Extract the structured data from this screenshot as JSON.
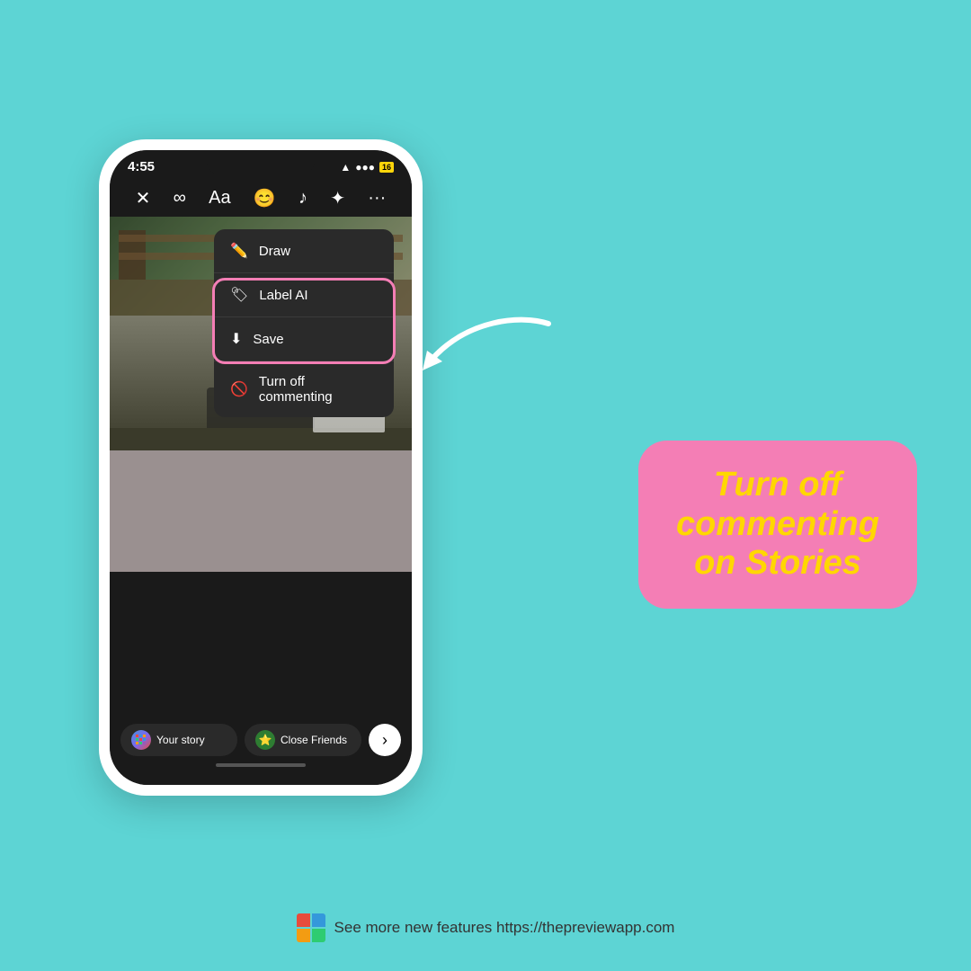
{
  "background": {
    "color": "#5dd4d4"
  },
  "phone": {
    "status_bar": {
      "time": "4:55",
      "wifi_icon": "wifi",
      "battery_label": "16"
    },
    "toolbar": {
      "icons": [
        "✕",
        "∞",
        "Aa",
        "😊",
        "♪",
        "✦",
        "···"
      ]
    },
    "dropdown": {
      "items": [
        {
          "icon": "✏",
          "label": "Draw"
        },
        {
          "icon": "🏷",
          "label": "Label AI"
        },
        {
          "icon": "⬇",
          "label": "Save"
        },
        {
          "icon": "🚫",
          "label": "Turn off commenting"
        }
      ]
    },
    "story_buttons": {
      "your_story_label": "Your story",
      "close_friends_label": "Close Friends"
    }
  },
  "feature_bubble": {
    "text": "Turn off commenting on Stories"
  },
  "footer": {
    "text": "See more new features https://thepreviewapp.com"
  }
}
